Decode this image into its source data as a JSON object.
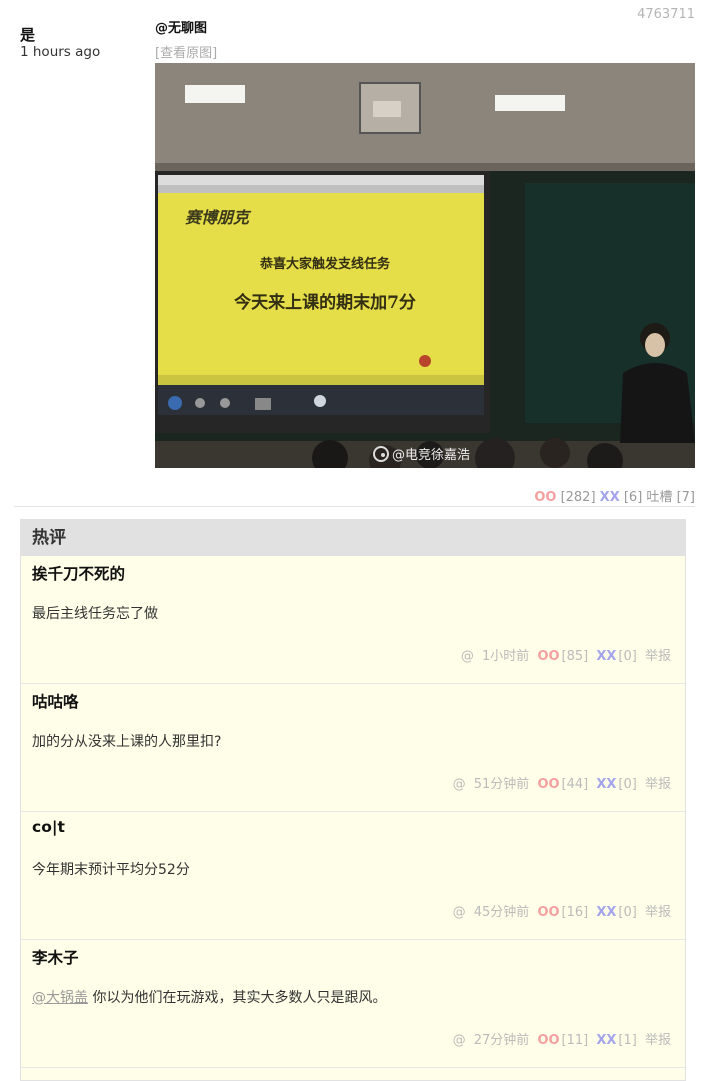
{
  "post": {
    "id": "4763711",
    "author": "是",
    "time": "1 hours ago",
    "mention": "@无聊图",
    "view_original": "[查看原图]",
    "image": {
      "watermark": "@电竞徐嘉浩",
      "slide_logo": "赛博朋克",
      "slide_line1": "恭喜大家触发支线任务",
      "slide_line2": "今天来上课的期末加7分"
    },
    "votes": {
      "oo_label": "OO",
      "oo_count": "[282]",
      "xx_label": "XX",
      "xx_count": "[6]",
      "tucao_label": "吐槽",
      "tucao_count": "[7]"
    }
  },
  "hot_comments": {
    "title": "热评",
    "items": [
      {
        "author": "挨千刀不死的",
        "mention": "",
        "text": "最后主线任务忘了做",
        "at": "@",
        "time": "1小时前",
        "oo_label": "OO",
        "oo": "[85]",
        "xx_label": "XX",
        "xx": "[0]",
        "report": "举报"
      },
      {
        "author": "咕咕咯",
        "mention": "",
        "text": "加的分从没来上课的人那里扣?",
        "at": "@",
        "time": "51分钟前",
        "oo_label": "OO",
        "oo": "[44]",
        "xx_label": "XX",
        "xx": "[0]",
        "report": "举报"
      },
      {
        "author": "co|t",
        "mention": "",
        "text": "今年期末预计平均分52分",
        "at": "@",
        "time": "45分钟前",
        "oo_label": "OO",
        "oo": "[16]",
        "xx_label": "XX",
        "xx": "[0]",
        "report": "举报"
      },
      {
        "author": "李木子",
        "mention": "@大锅盖",
        "text": " 你以为他们在玩游戏，其实大多数人只是跟风。",
        "at": "@",
        "time": "27分钟前",
        "oo_label": "OO",
        "oo": "[11]",
        "xx_label": "XX",
        "xx": "[1]",
        "report": "举报"
      }
    ]
  }
}
